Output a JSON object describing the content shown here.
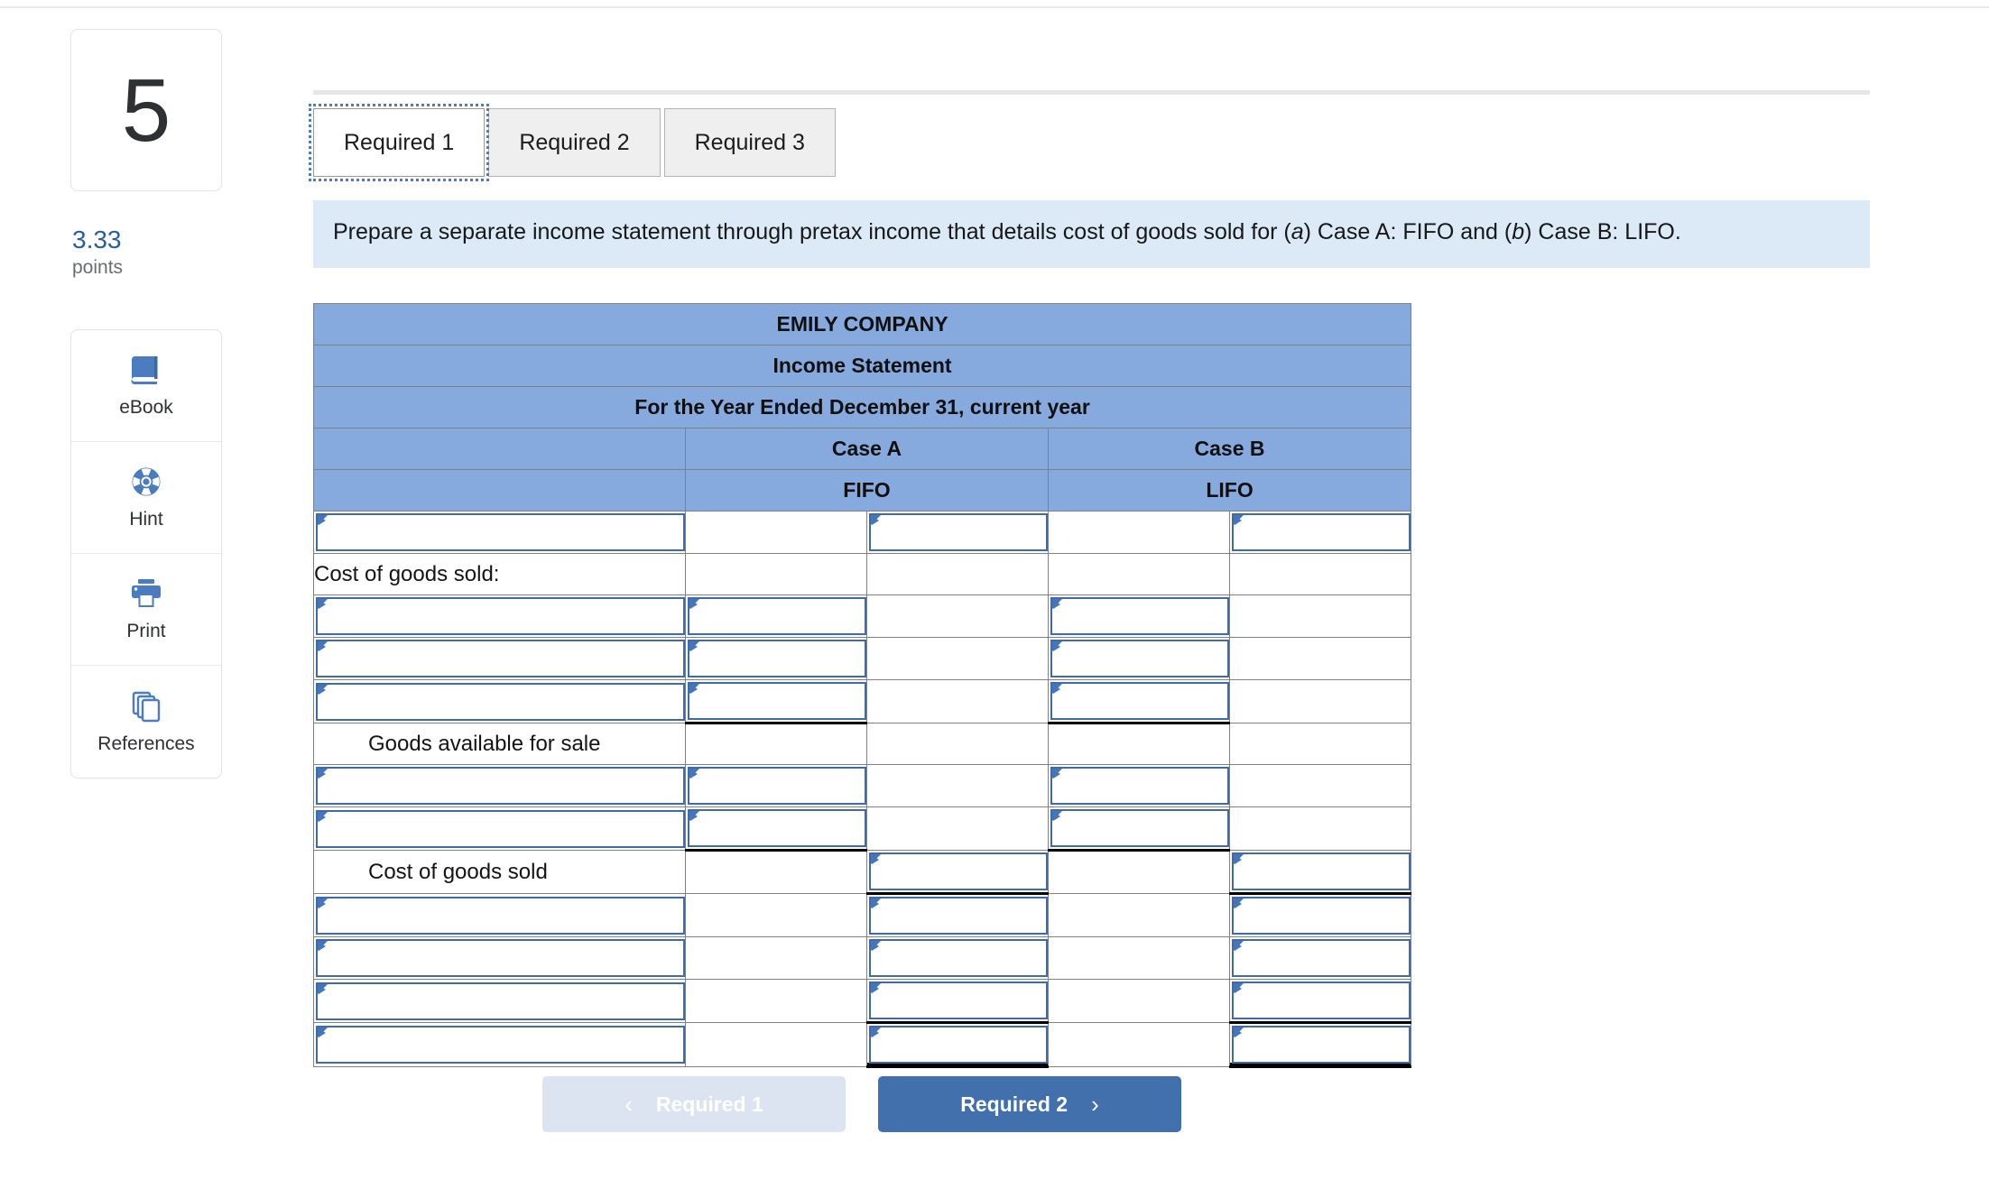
{
  "sidebar": {
    "question_number": "5",
    "points_value": "3.33",
    "points_label": "points",
    "tools": [
      {
        "icon": "ebook-icon",
        "label": "eBook"
      },
      {
        "icon": "hint-lifering-icon",
        "label": "Hint"
      },
      {
        "icon": "printer-icon",
        "label": "Print"
      },
      {
        "icon": "references-pages-icon",
        "label": "References"
      }
    ]
  },
  "tabs": [
    {
      "label": "Required 1",
      "active": true
    },
    {
      "label": "Required 2",
      "active": false
    },
    {
      "label": "Required 3",
      "active": false
    }
  ],
  "instruction": {
    "part1": "Prepare a separate income statement through pretax income that details cost of goods sold for (",
    "em_a": "a",
    "part2": ") Case A: FIFO and (",
    "em_b": "b",
    "part3": ") Case B: LIFO."
  },
  "worksheet": {
    "title_line_1": "EMILY COMPANY",
    "title_line_2": "Income Statement",
    "title_line_3": "For the Year Ended December 31, current year",
    "case_a": "Case A",
    "case_b": "Case B",
    "method_a": "FIFO",
    "method_b": "LIFO",
    "rows": [
      {
        "type": "input",
        "label": "",
        "cells": [
          "none",
          "dd",
          "none",
          "dd"
        ]
      },
      {
        "type": "label",
        "label": "Cost of goods sold:",
        "indent": false,
        "cells": [
          "none",
          "none",
          "none",
          "none"
        ]
      },
      {
        "type": "input",
        "label": "",
        "cells": [
          "dd",
          "none",
          "dd",
          "none"
        ]
      },
      {
        "type": "input",
        "label": "",
        "cells": [
          "dd",
          "none",
          "dd",
          "none"
        ]
      },
      {
        "type": "input",
        "label": "",
        "cells": [
          "dd-ul",
          "none",
          "dd-ul",
          "none"
        ]
      },
      {
        "type": "label",
        "label": "Goods available for sale",
        "indent": true,
        "cells": [
          "none",
          "none",
          "none",
          "none"
        ]
      },
      {
        "type": "input",
        "label": "",
        "cells": [
          "dd",
          "none",
          "dd",
          "none"
        ]
      },
      {
        "type": "input",
        "label": "",
        "cells": [
          "dd-ul",
          "none",
          "dd-ul",
          "none"
        ]
      },
      {
        "type": "label",
        "label": "Cost of goods sold",
        "indent": true,
        "cells": [
          "none",
          "dd-ul",
          "none",
          "dd-ul"
        ]
      },
      {
        "type": "input",
        "label": "",
        "cells": [
          "none",
          "dd",
          "none",
          "dd"
        ]
      },
      {
        "type": "input",
        "label": "",
        "cells": [
          "none",
          "dd",
          "none",
          "dd"
        ]
      },
      {
        "type": "input",
        "label": "",
        "cells": [
          "none",
          "dd-ul",
          "none",
          "dd-ul"
        ]
      },
      {
        "type": "input",
        "label": "",
        "cells": [
          "none",
          "dd-dbl",
          "none",
          "dd-dbl"
        ]
      }
    ]
  },
  "nav": {
    "prev_label": "Required 1",
    "next_label": "Required 2",
    "prev_chevron": "‹",
    "next_chevron": "›"
  },
  "colors": {
    "header_blue": "#87aade",
    "banner_blue": "#dceaf7",
    "accent_blue": "#4170ad",
    "points_blue": "#2a5d9f",
    "input_border": "#3f6aac"
  }
}
